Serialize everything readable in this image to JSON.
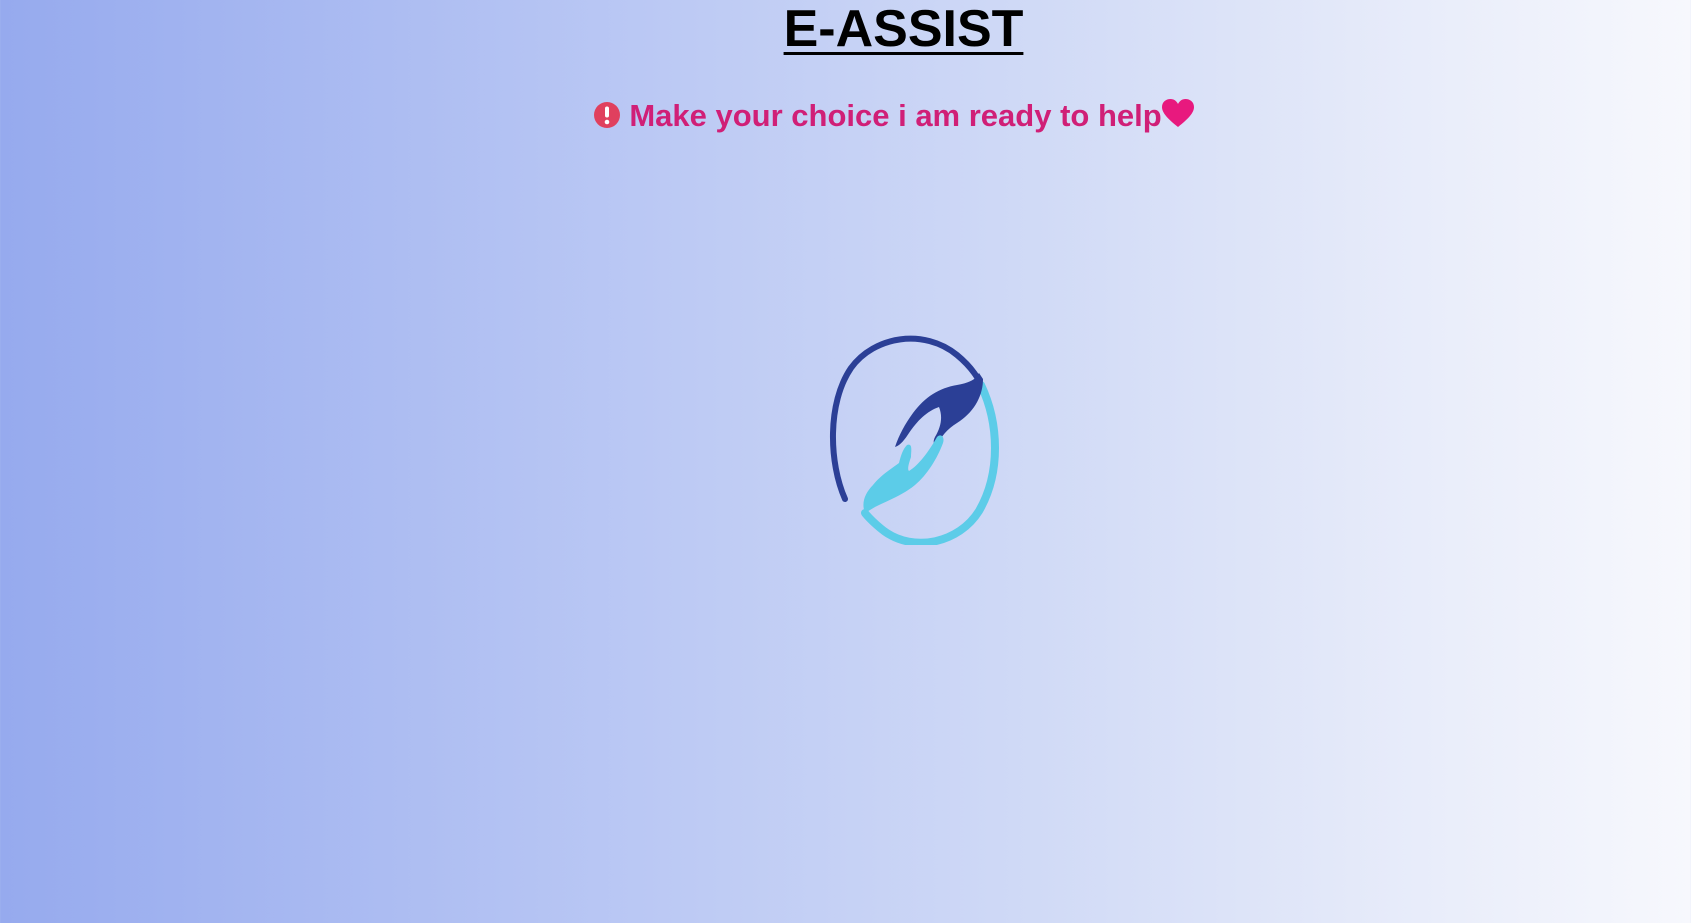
{
  "header": {
    "title": "E-ASSIST",
    "tagline": "Make your choice i am ready to help"
  },
  "icons": {
    "alert": "exclamation-circle-icon",
    "heart": "heart-icon",
    "logo": "helping-hands-logo"
  },
  "colors": {
    "title": "#000000",
    "tagline": "#d01f77",
    "alert_icon": "#e0405e",
    "heart": "#e8197e",
    "logo_dark": "#2b3f96",
    "logo_light": "#5ccce8"
  }
}
